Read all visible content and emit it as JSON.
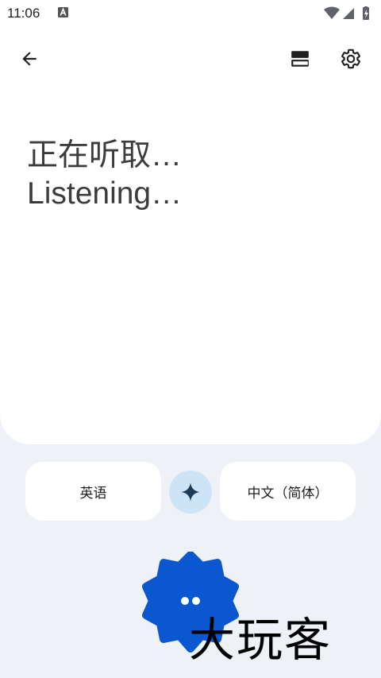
{
  "status_bar": {
    "time": "11:06",
    "notification_icon": "a-letter-icon",
    "icons": [
      "wifi-icon",
      "signal-icon",
      "battery-icon"
    ]
  },
  "toolbar": {
    "back_icon": "arrow-back-icon",
    "layout_icon": "layout-toggle-icon",
    "settings_icon": "gear-icon"
  },
  "transcript": {
    "line_zh": "正在听取…",
    "line_en": "Listening…"
  },
  "languages": {
    "source": "英语",
    "target": "中文（简体）",
    "swap_icon": "sparkle-icon"
  },
  "mic": {
    "icon": "listening-dots-icon",
    "color": "#0b57d0"
  },
  "watermark": "大玩客",
  "colors": {
    "background": "#eef1f6",
    "card": "#ffffff",
    "swap_button": "#cde4f7",
    "mic_button": "#0b57d0"
  }
}
